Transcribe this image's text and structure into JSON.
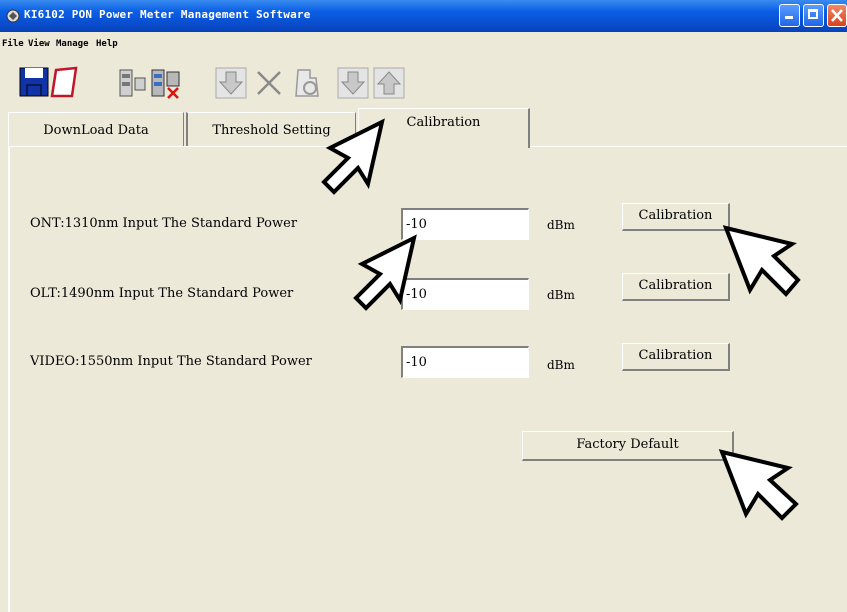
{
  "window": {
    "title": "KI6102 PON Power Meter Management Software"
  },
  "menu": [
    {
      "label": "File"
    },
    {
      "label": "View"
    },
    {
      "label": "Manage"
    },
    {
      "label": "Help"
    }
  ],
  "toolbar": {
    "icons": [
      "save-icon",
      "open-icon",
      "device-icon",
      "device-remove-icon",
      "download-icon",
      "delete-icon",
      "clear-icon",
      "download-alt-icon",
      "upload-icon"
    ]
  },
  "tabs": [
    {
      "label": "DownLoad Data"
    },
    {
      "label": "Threshold Setting"
    },
    {
      "label": "Calibration",
      "active": true
    }
  ],
  "calibration": {
    "rows": [
      {
        "label": "ONT:1310nm  Input The Standard Power",
        "value": "-10",
        "unit": "dBm",
        "button": "Calibration"
      },
      {
        "label": "OLT:1490nm  Input The Standard Power",
        "value": "-10",
        "unit": "dBm",
        "button": "Calibration"
      },
      {
        "label": "VIDEO:1550nm Input The Standard Power",
        "value": "-10",
        "unit": "dBm",
        "button": "Calibration"
      }
    ],
    "factory_default": "Factory Default"
  },
  "colors": {
    "titlebar": "#0b5fe6",
    "window_bg": "#ece9d8"
  }
}
